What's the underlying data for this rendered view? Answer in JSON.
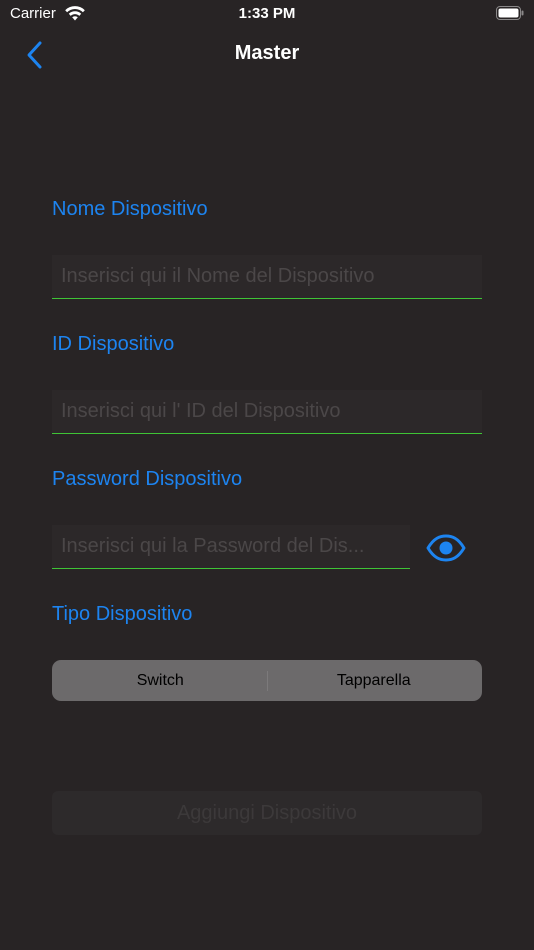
{
  "status_bar": {
    "carrier": "Carrier",
    "time": "1:33 PM",
    "icons": [
      "wifi-icon",
      "battery-icon"
    ]
  },
  "nav": {
    "title": "Master",
    "back_icon": "chevron-left-icon"
  },
  "form": {
    "name": {
      "label": "Nome Dispositivo",
      "value": "",
      "placeholder": "Inserisci qui il Nome del Dispositivo"
    },
    "id": {
      "label": "ID Dispositivo",
      "value": "",
      "placeholder": "Inserisci qui l' ID del Dispositivo"
    },
    "password": {
      "label": "Password Dispositivo",
      "value": "",
      "placeholder": "Inserisci qui la Password del Dis...",
      "toggle_icon": "eye-icon"
    },
    "type": {
      "label": "Tipo Dispositivo",
      "options": [
        "Switch",
        "Tapparella"
      ]
    },
    "submit_label": "Aggiungi Dispositivo"
  },
  "colors": {
    "background": "#282425",
    "accent": "#1d84f0",
    "input_underline": "#3fc436",
    "segment_background": "#6c6a6b",
    "disabled_text": "#3c393a"
  }
}
